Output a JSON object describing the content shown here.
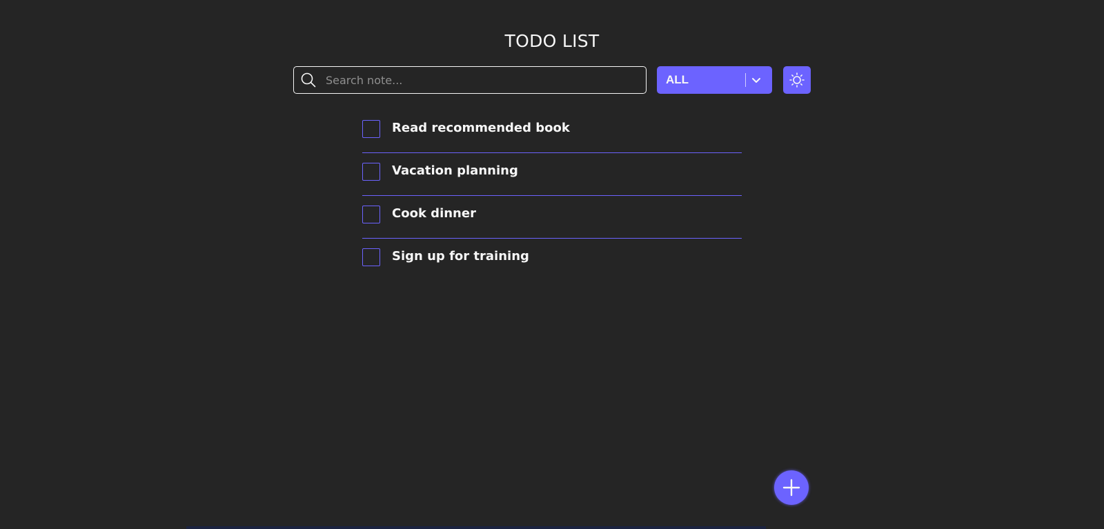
{
  "header": {
    "title": "TODO LIST"
  },
  "search": {
    "placeholder": "Search note...",
    "value": "",
    "icon": "search-icon"
  },
  "filter": {
    "selected": "ALL",
    "icon": "chevron-down-icon"
  },
  "theme_toggle": {
    "icon": "sun-icon"
  },
  "todos": [
    {
      "text": "Read recommended book",
      "checked": false
    },
    {
      "text": "Vacation planning",
      "checked": false
    },
    {
      "text": "Cook dinner",
      "checked": false
    },
    {
      "text": "Sign up for training",
      "checked": false
    }
  ],
  "add_button": {
    "icon": "plus-icon"
  },
  "colors": {
    "background": "#252525",
    "accent": "#6c63ff",
    "text": "#f7f7f7",
    "placeholder": "#8f8f8f"
  }
}
